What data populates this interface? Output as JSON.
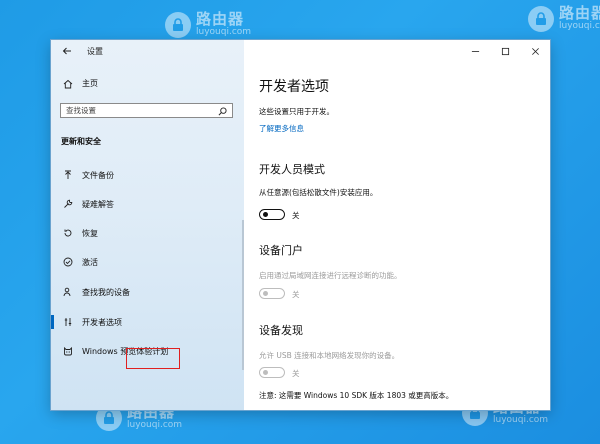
{
  "watermark": {
    "cn": "路由器",
    "en": "luyouqi.com"
  },
  "window": {
    "title": "设置"
  },
  "sidebar": {
    "home_label": "主页",
    "search_placeholder": "查找设置",
    "section_title": "更新和安全",
    "items": [
      {
        "label": "文件备份",
        "icon": "backup-arrow-icon"
      },
      {
        "label": "疑难解答",
        "icon": "wrench-icon"
      },
      {
        "label": "恢复",
        "icon": "recovery-icon"
      },
      {
        "label": "激活",
        "icon": "check-circle-icon"
      },
      {
        "label": "查找我的设备",
        "icon": "person-locate-icon"
      },
      {
        "label": "开发者选项",
        "icon": "developer-tools-icon",
        "selected": true
      },
      {
        "label": "Windows 预览体验计划",
        "icon": "insider-cat-icon"
      }
    ]
  },
  "content": {
    "title": "开发者选项",
    "description": "这些设置只用于开发。",
    "learn_more": "了解更多信息",
    "dev_mode": {
      "heading": "开发人员模式",
      "desc": "从任意源(包括松散文件)安装应用。",
      "state": "关"
    },
    "device_portal": {
      "heading": "设备门户",
      "desc": "启用通过局域网连接进行远程诊断的功能。",
      "state": "关"
    },
    "device_discovery": {
      "heading": "设备发现",
      "desc": "允许 USB 连接和本地网络发现你的设备。",
      "state": "关"
    },
    "note": "注意: 这需要 Windows 10 SDK 版本 1803 或更高版本。"
  },
  "colors": {
    "accent": "#0067c0",
    "highlight": "#e02020",
    "background": "#1f9be6"
  }
}
